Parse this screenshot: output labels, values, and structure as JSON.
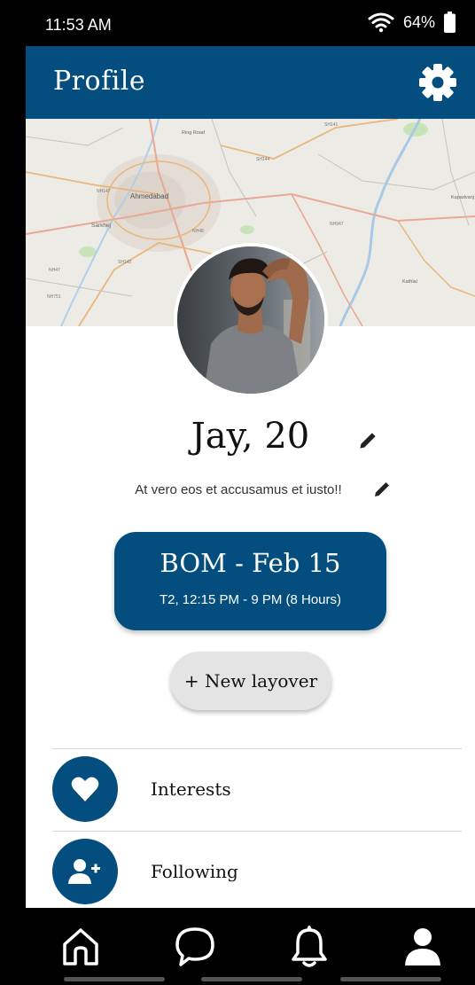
{
  "status_bar": {
    "time": "11:53 AM",
    "battery": "64%"
  },
  "app_bar": {
    "title": "Profile",
    "settings_icon": "gear-icon"
  },
  "profile": {
    "name": "Jay, 20",
    "bio": "At vero eos et accusamus et iusto!!"
  },
  "map": {
    "labels": [
      "Ahmedabad",
      "Sarkhej",
      "Ring Road",
      "Kapadvanj",
      "Kathlal",
      "SH141",
      "SH144",
      "NH147",
      "NH947",
      "NH48",
      "NH47",
      "NH751",
      "SH142",
      "SH141"
    ]
  },
  "layover": {
    "title": "BOM - Feb 15",
    "details": "T2, 12:15 PM - 9 PM (8 Hours)"
  },
  "new_layover_button": "+ New layover",
  "menu": [
    {
      "label": "Interests",
      "icon": "heart-icon"
    },
    {
      "label": "Following",
      "icon": "add-user-icon"
    }
  ],
  "bottom_nav": [
    {
      "icon": "home-icon"
    },
    {
      "icon": "chat-icon"
    },
    {
      "icon": "bell-icon"
    },
    {
      "icon": "profile-icon",
      "active": true
    }
  ],
  "colors": {
    "primary": "#034e7e",
    "button_grey": "#e4e4e4"
  }
}
